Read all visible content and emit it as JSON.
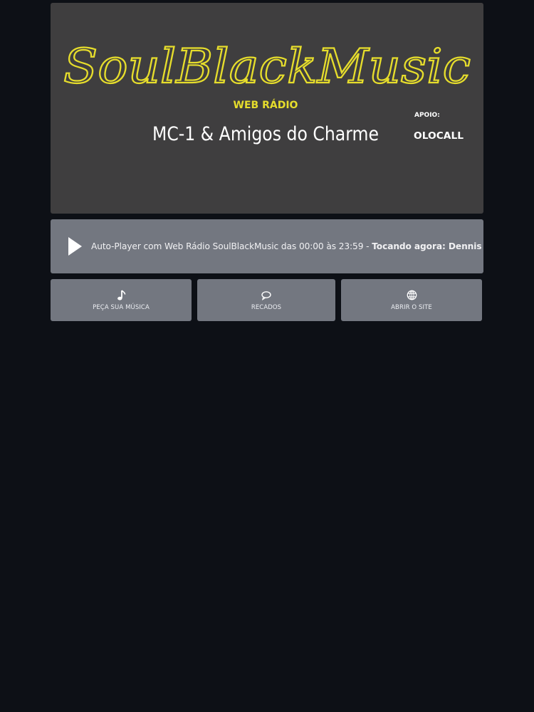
{
  "banner": {
    "brand": "SoulBlackMusic",
    "subtitle": "WEB RÁDIO",
    "program": "MC-1 & Amigos do Charme",
    "support_label": "APOIO:",
    "sponsor": "OLOCALL",
    "colors": {
      "brand": "#e6dd2c",
      "background": "#3f3e3f"
    }
  },
  "player": {
    "play_icon": "play-icon",
    "schedule_text": "Auto-Player com Web Rádio SoulBlackMusic das 00:00 às 23:59 - ",
    "now_playing": "Tocando agora: Dennis Taylor Over &."
  },
  "actions": [
    {
      "icon": "music-note-icon",
      "label": "PEÇA SUA MÚSICA"
    },
    {
      "icon": "chat-bubble-icon",
      "label": "RECADOS"
    },
    {
      "icon": "globe-icon",
      "label": "ABRIR O SITE"
    }
  ],
  "theme": {
    "page_bg": "#0d1016",
    "panel_bg": "#737780",
    "text": "#f1f1f3"
  }
}
